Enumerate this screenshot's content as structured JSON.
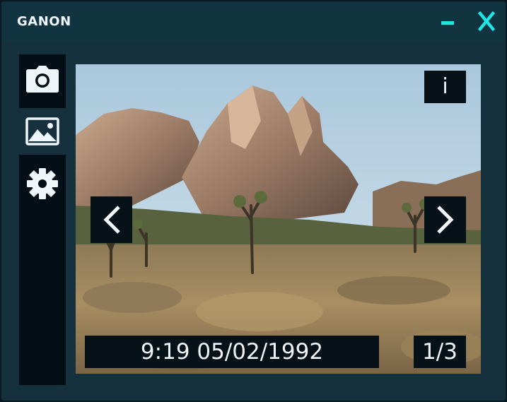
{
  "window": {
    "title": "GANON"
  },
  "titlebar": {
    "minimize_icon": "minimize-icon",
    "close_icon": "close-icon",
    "accent_color": "#1ee7e4"
  },
  "sidebar": {
    "items": [
      {
        "name": "camera",
        "icon": "camera-icon",
        "active": false
      },
      {
        "name": "gallery",
        "icon": "image-icon",
        "active": true
      },
      {
        "name": "settings",
        "icon": "gear-icon",
        "active": false
      }
    ]
  },
  "viewer": {
    "info_label": "i",
    "prev_icon": "chevron-left-icon",
    "next_icon": "chevron-right-icon",
    "timestamp": "9:19 05/02/1992",
    "counter": "1/3",
    "photo_subject": "desert-rock-landscape"
  }
}
